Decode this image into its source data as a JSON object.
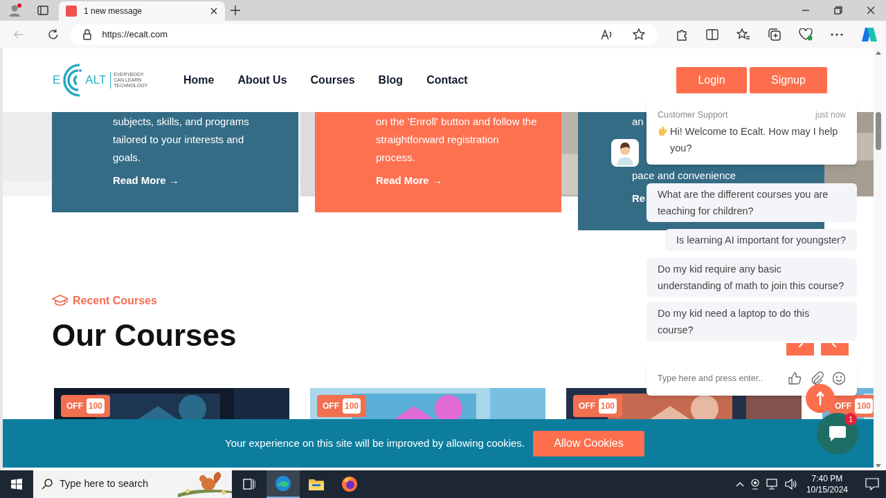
{
  "browser": {
    "tab_title": "1 new message",
    "address": "https://ecalt.com"
  },
  "header": {
    "logo": {
      "left": "E",
      "right": "ALT",
      "tagline": [
        "EVERYBODY",
        "CAN LEARN",
        "TECHNOLOGY"
      ]
    },
    "nav": [
      "Home",
      "About Us",
      "Courses",
      "Blog",
      "Contact"
    ],
    "buttons": [
      "Login",
      "Signup"
    ]
  },
  "cards": [
    {
      "color": "#346b85",
      "lines": [
        "subjects, skills, and programs",
        "tailored to your interests and",
        "goals."
      ],
      "link": "Read More →"
    },
    {
      "color": "#fd7150",
      "lines": [
        "on the 'Enroll' button and follow the",
        "straightforward registration",
        "process."
      ],
      "link": "Read More →"
    },
    {
      "kind": "covered",
      "color": "#346b85",
      "lines": [
        "an",
        "pace and convenience"
      ],
      "link": "Re"
    }
  ],
  "section": {
    "eyebrow": "Recent Courses",
    "title": "Our Courses"
  },
  "courses": [
    {
      "off": "OFF",
      "value": "100"
    },
    {
      "off": "OFF",
      "value": "100"
    },
    {
      "off": "OFF",
      "value": "100"
    },
    {
      "off": "OFF",
      "value": "100"
    }
  ],
  "cookie": {
    "text": "Your experience on this site will be improved by allowing cookies.",
    "button": "Allow Cookies"
  },
  "chat": {
    "sender": "Customer Support",
    "time": "just now",
    "greeting": "Hi! Welcome to Ecalt. How may I help you?",
    "replies": [
      "What are the different courses you are teaching for children?",
      "Is learning AI important for youngster?",
      "Do my kid require any basic understanding of math to join this course?",
      "Do my kid need a laptop to do this course?"
    ],
    "placeholder": "Type here and press enter..",
    "unread": "1"
  },
  "taskbar": {
    "search": "Type here to search",
    "time": "7:40 PM",
    "date": "10/15/2024"
  }
}
